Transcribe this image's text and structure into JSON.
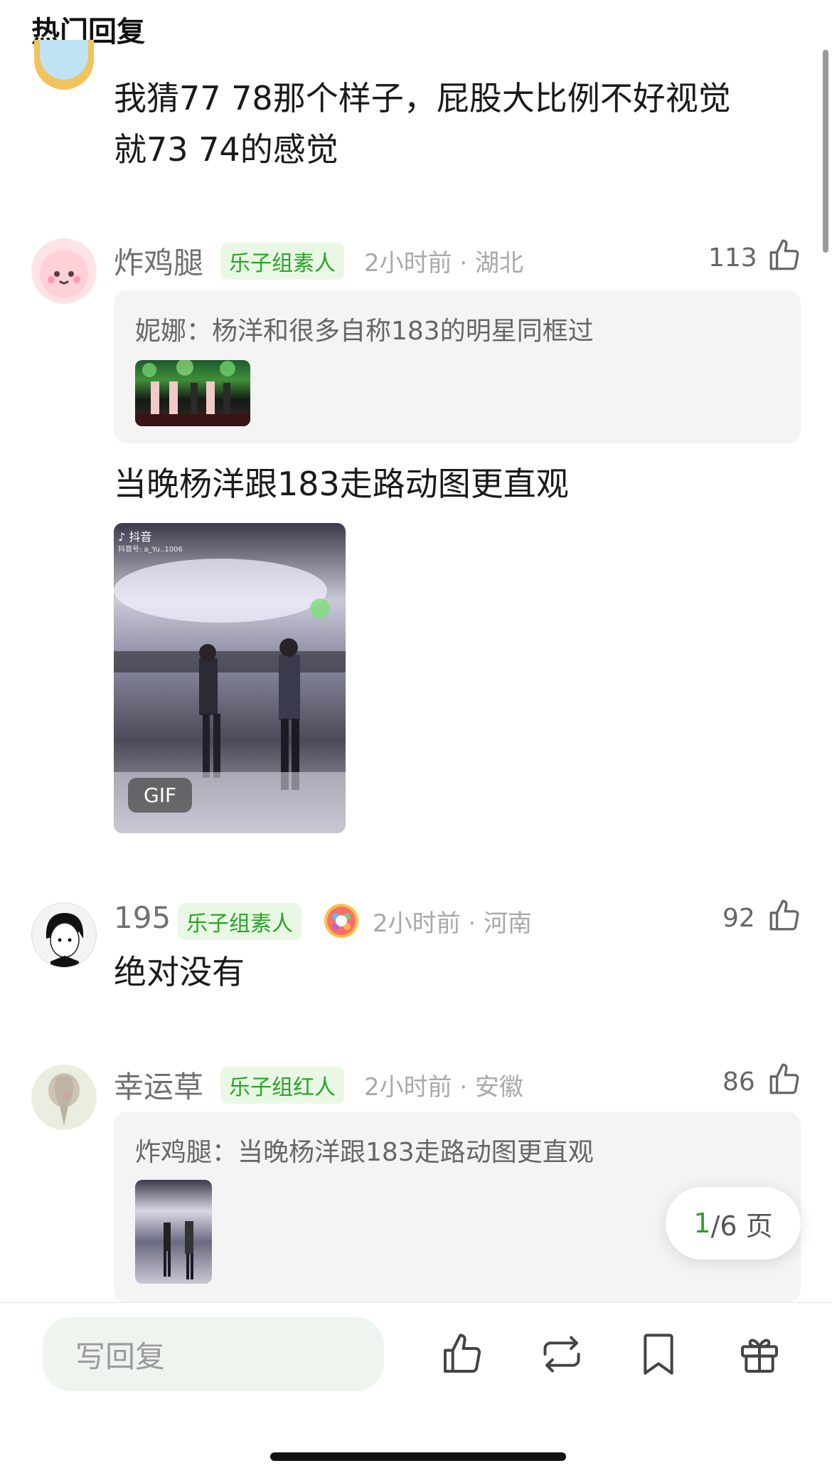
{
  "section_title": "热门回复",
  "comments": [
    {
      "text_line1": "我猜77 78那个样子，屁股大比例不好视觉",
      "text_line2": "就73 74的感觉"
    },
    {
      "name": "炸鸡腿",
      "badge": "乐子组素人",
      "meta": "2小时前 · 湖北",
      "likes": "113",
      "quote": "妮娜：杨洋和很多自称183的明星同框过",
      "text": "当晚杨洋跟183走路动图更直观",
      "gif_label": "GIF",
      "gif_watermark": "抖音",
      "gif_watermark_id": "抖音号: a_Yu..1006"
    },
    {
      "name": "195",
      "badge": "乐子组素人",
      "meta": "2小时前 · 河南",
      "likes": "92",
      "text": "绝对没有"
    },
    {
      "name": "幸运草",
      "badge": "乐子组红人",
      "meta": "2小时前 · 安徽",
      "likes": "86",
      "quote": "炸鸡腿：当晚杨洋跟183走路动图更直观"
    }
  ],
  "pager": {
    "current": "1",
    "rest": "/6 页"
  },
  "bottom_bar": {
    "reply_placeholder": "写回复",
    "icons": [
      "like-icon",
      "repost-icon",
      "bookmark-icon",
      "gift-icon"
    ]
  },
  "colors": {
    "accent_green": "#2aa42a",
    "badge_bg": "#e9f8e4",
    "quote_bg": "#f4f4f4"
  }
}
